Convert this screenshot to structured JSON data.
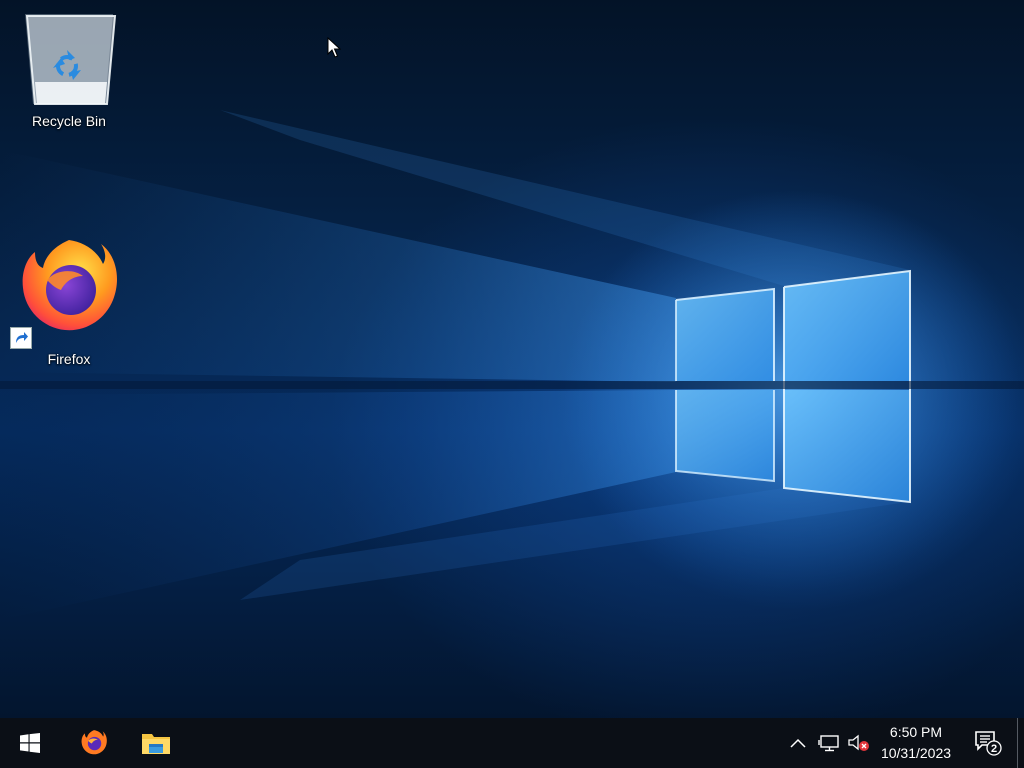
{
  "desktop": {
    "icons": [
      {
        "label": "Recycle Bin",
        "icon": "recycle-bin-icon"
      },
      {
        "label": "Firefox",
        "icon": "firefox-icon",
        "shortcut": true
      }
    ]
  },
  "taskbar": {
    "start_icon": "windows-logo-icon",
    "pinned": [
      {
        "icon": "firefox-icon"
      },
      {
        "icon": "file-explorer-icon"
      }
    ],
    "tray": {
      "chevron_icon": "chevron-up-icon",
      "network_icon": "network-icon",
      "volume_icon": "volume-muted-icon",
      "time": "6:50 PM",
      "date": "10/31/2023",
      "notification_count": "2"
    }
  },
  "colors": {
    "taskbar_bg": "#0b0f16",
    "accent_blue": "#2a86e8"
  }
}
